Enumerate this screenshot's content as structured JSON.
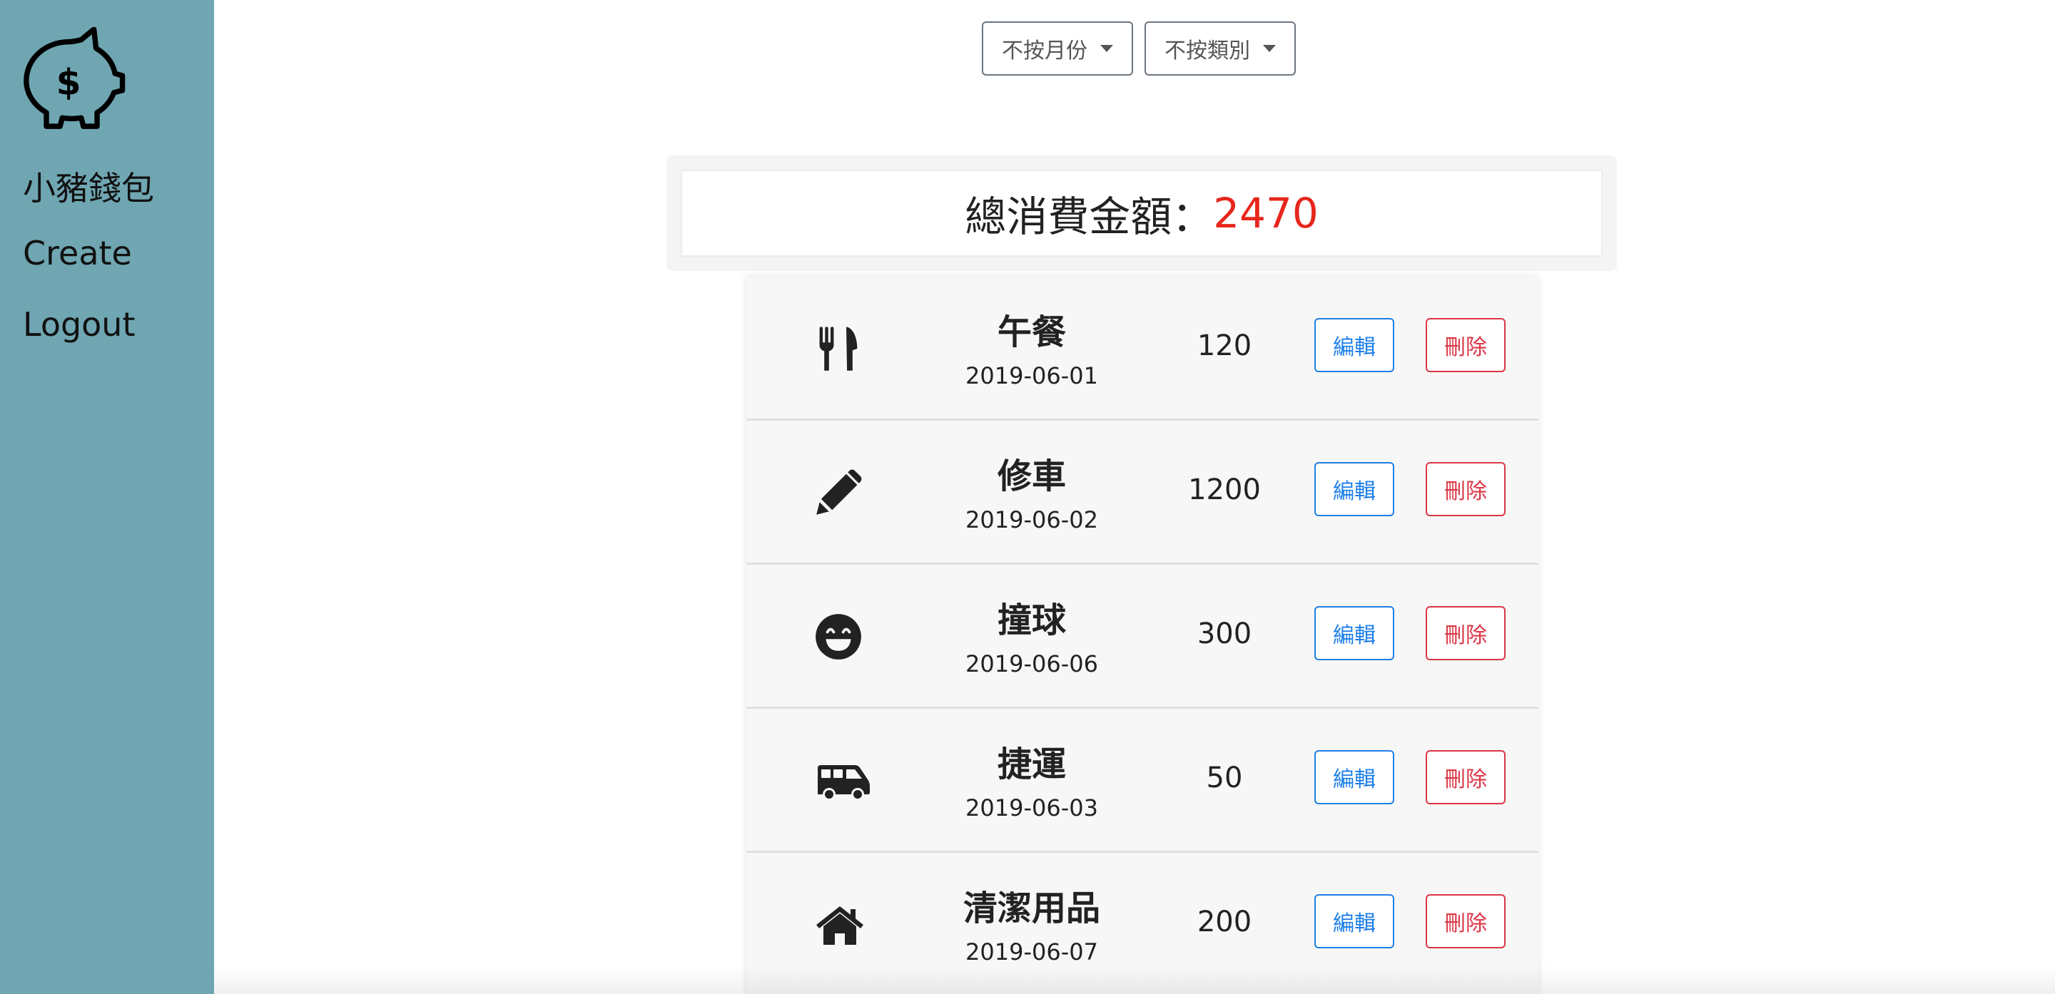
{
  "app": {
    "name": "小豬錢包"
  },
  "sidebar": {
    "items": [
      {
        "label": "小豬錢包"
      },
      {
        "label": "Create"
      },
      {
        "label": "Logout"
      }
    ]
  },
  "filters": {
    "month_label": "不按月份",
    "category_label": "不按類別"
  },
  "summary": {
    "label": "總消費金額：",
    "value": "2470",
    "value_color": "#e8261c"
  },
  "records": [
    {
      "icon": "utensils-icon",
      "name": "午餐",
      "date": "2019-06-01",
      "amount": "120",
      "edit_label": "編輯",
      "delete_label": "刪除"
    },
    {
      "icon": "pencil-icon",
      "name": "修車",
      "date": "2019-06-02",
      "amount": "1200",
      "edit_label": "編輯",
      "delete_label": "刪除"
    },
    {
      "icon": "grin-icon",
      "name": "撞球",
      "date": "2019-06-06",
      "amount": "300",
      "edit_label": "編輯",
      "delete_label": "刪除"
    },
    {
      "icon": "shuttle-van-icon",
      "name": "捷運",
      "date": "2019-06-03",
      "amount": "50",
      "edit_label": "編輯",
      "delete_label": "刪除"
    },
    {
      "icon": "home-icon",
      "name": "清潔用品",
      "date": "2019-06-07",
      "amount": "200",
      "edit_label": "編輯",
      "delete_label": "刪除"
    }
  ],
  "colors": {
    "sidebar": "#6fa6b2",
    "edit": "#1d7fe6",
    "delete": "#dc3545"
  }
}
